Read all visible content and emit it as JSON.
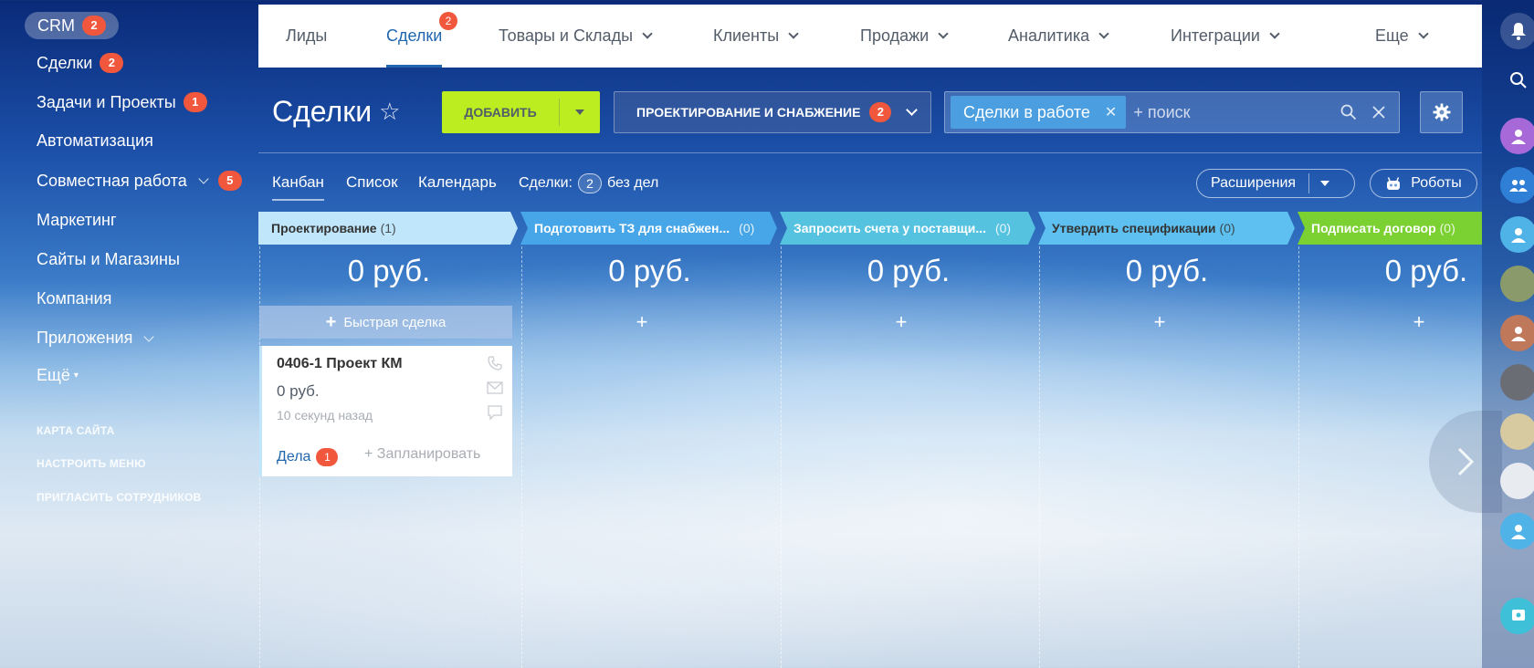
{
  "sidebar": {
    "items": [
      {
        "label": "CRM",
        "badge": "2"
      },
      {
        "label": "Сделки",
        "badge": "2"
      },
      {
        "label": "Задачи и Проекты",
        "badge": "1"
      },
      {
        "label": "Автоматизация"
      },
      {
        "label": "Совместная работа",
        "badge": "5"
      },
      {
        "label": "Маркетинг"
      },
      {
        "label": "Сайты и Магазины"
      },
      {
        "label": "Компания"
      },
      {
        "label": "Приложения"
      },
      {
        "label": "Ещё"
      }
    ],
    "links": [
      "КАРТА САЙТА",
      "НАСТРОИТЬ МЕНЮ",
      "ПРИГЛАСИТЬ СОТРУДНИКОВ"
    ]
  },
  "topnav": {
    "items": [
      {
        "label": "Лиды"
      },
      {
        "label": "Сделки",
        "badge": "2"
      },
      {
        "label": "Товары и Склады"
      },
      {
        "label": "Клиенты"
      },
      {
        "label": "Продажи"
      },
      {
        "label": "Аналитика"
      },
      {
        "label": "Интеграции"
      },
      {
        "label": "Еще"
      }
    ]
  },
  "toolbar": {
    "title": "Сделки",
    "add_label": "ДОБАВИТЬ",
    "direction_label": "ПРОЕКТИРОВАНИЕ И СНАБЖЕНИЕ",
    "direction_badge": "2",
    "filter_chip": "Сделки в работе",
    "search_placeholder": "+ поиск"
  },
  "views": {
    "tabs": [
      "Канбан",
      "Список",
      "Календарь"
    ],
    "deals_label": "Сделки:",
    "deals_count": "2",
    "deals_suffix": "без дел",
    "extensions_label": "Расширения",
    "robots_label": "Роботы"
  },
  "kanban": {
    "quick_deal_label": "Быстрая сделка",
    "columns": [
      {
        "title": "Проектирование",
        "count": "(1)",
        "sum": "0 руб.",
        "color": "#bfe6fb"
      },
      {
        "title": "Подготовить ТЗ для снабжен...",
        "count": "(0)",
        "sum": "0 руб.",
        "color": "#47a6e8"
      },
      {
        "title": "Запросить счета у поставщи...",
        "count": "(0)",
        "sum": "0 руб.",
        "color": "#55c2e0"
      },
      {
        "title": "Утвердить спецификации",
        "count": "(0)",
        "sum": "0 руб.",
        "color": "#5dc0f0"
      },
      {
        "title": "Подписать договор",
        "count": "(0)",
        "sum": "0 руб.",
        "color": "#7bd032"
      }
    ],
    "card": {
      "title": "0406-1 Проект КМ",
      "sum": "0 руб.",
      "time": "10 секунд назад",
      "tasks_label": "Дела",
      "tasks_count": "1",
      "plan_label": "+ Запланировать"
    }
  },
  "colors": {
    "accent": "#2067b0",
    "badge": "#f1573d",
    "add_button": "#bbed21"
  }
}
